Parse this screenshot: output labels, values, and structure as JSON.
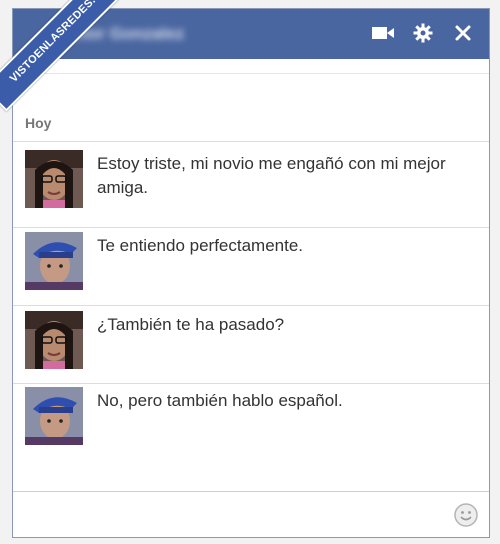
{
  "chat": {
    "contact_name": "Victor Gonzalez",
    "day_label": "Hoy",
    "messages": [
      {
        "sender": "girl",
        "text": "Estoy triste, mi novio me engañó con mi mejor amiga."
      },
      {
        "sender": "boy",
        "text": "Te entiendo perfectamente."
      },
      {
        "sender": "girl",
        "text": "¿También te ha pasado?"
      },
      {
        "sender": "boy",
        "text": "No, pero también hablo español."
      }
    ],
    "composer_value": ""
  },
  "watermark": {
    "text": "VISTOENLASREDES.COM"
  },
  "icons": {
    "video": "video-camera-icon",
    "settings": "gear-icon",
    "close": "close-icon",
    "emoji": "smiley-icon"
  },
  "colors": {
    "titlebar": "#4a66a0",
    "accent": "#3b5ca8"
  }
}
